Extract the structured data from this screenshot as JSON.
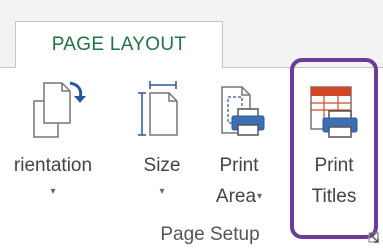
{
  "ribbon": {
    "active_tab": "PAGE LAYOUT"
  },
  "buttons": {
    "orientation": {
      "label": "rientation",
      "arrow": "▾"
    },
    "size": {
      "label": "Size",
      "arrow": "▾"
    },
    "print_area": {
      "label_line1": "Print",
      "label_line2": "Area",
      "arrow": "▾"
    },
    "print_titles": {
      "label_line1": "Print",
      "label_line2": "Titles"
    }
  },
  "group": {
    "label": "Page Setup"
  },
  "colors": {
    "tab_text": "#217346",
    "highlight": "#6a3d9a",
    "icon_blue": "#2b579a",
    "icon_red": "#d24726"
  }
}
